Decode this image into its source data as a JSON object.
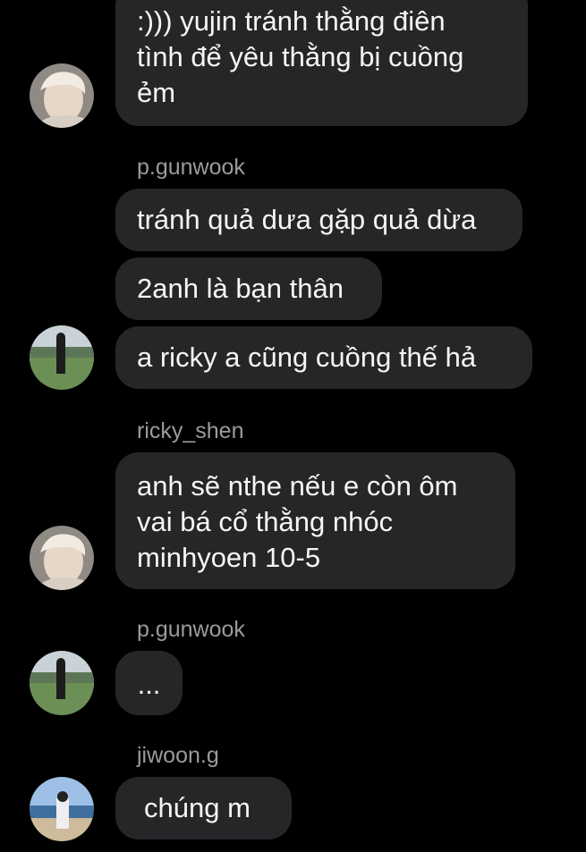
{
  "messages": [
    {
      "id": "m1",
      "text": ":))) yujin tránh thằng điên\ntình để yêu thằng bị cuồng\nẻm"
    },
    {
      "id": "m2",
      "sender": "p.gunwook",
      "text": "tránh quả dưa gặp quả dừa"
    },
    {
      "id": "m3",
      "text": "2anh là bạn thân"
    },
    {
      "id": "m4",
      "text": "a ricky a cũng cuồng thế hả"
    },
    {
      "id": "m5",
      "sender": "ricky_shen",
      "text": "anh sẽ nthe nếu e còn ôm\nvai bá cổ thằng nhóc\nminhyoen 10-5"
    },
    {
      "id": "m6",
      "sender": "p.gunwook",
      "text": "..."
    },
    {
      "id": "m7",
      "sender": "jiwoon.g",
      "text": "chúng m"
    }
  ],
  "colors": {
    "background": "#000000",
    "bubble": "#262629",
    "sender_name": "#9b9b9f",
    "text": "#f5f5f5"
  }
}
